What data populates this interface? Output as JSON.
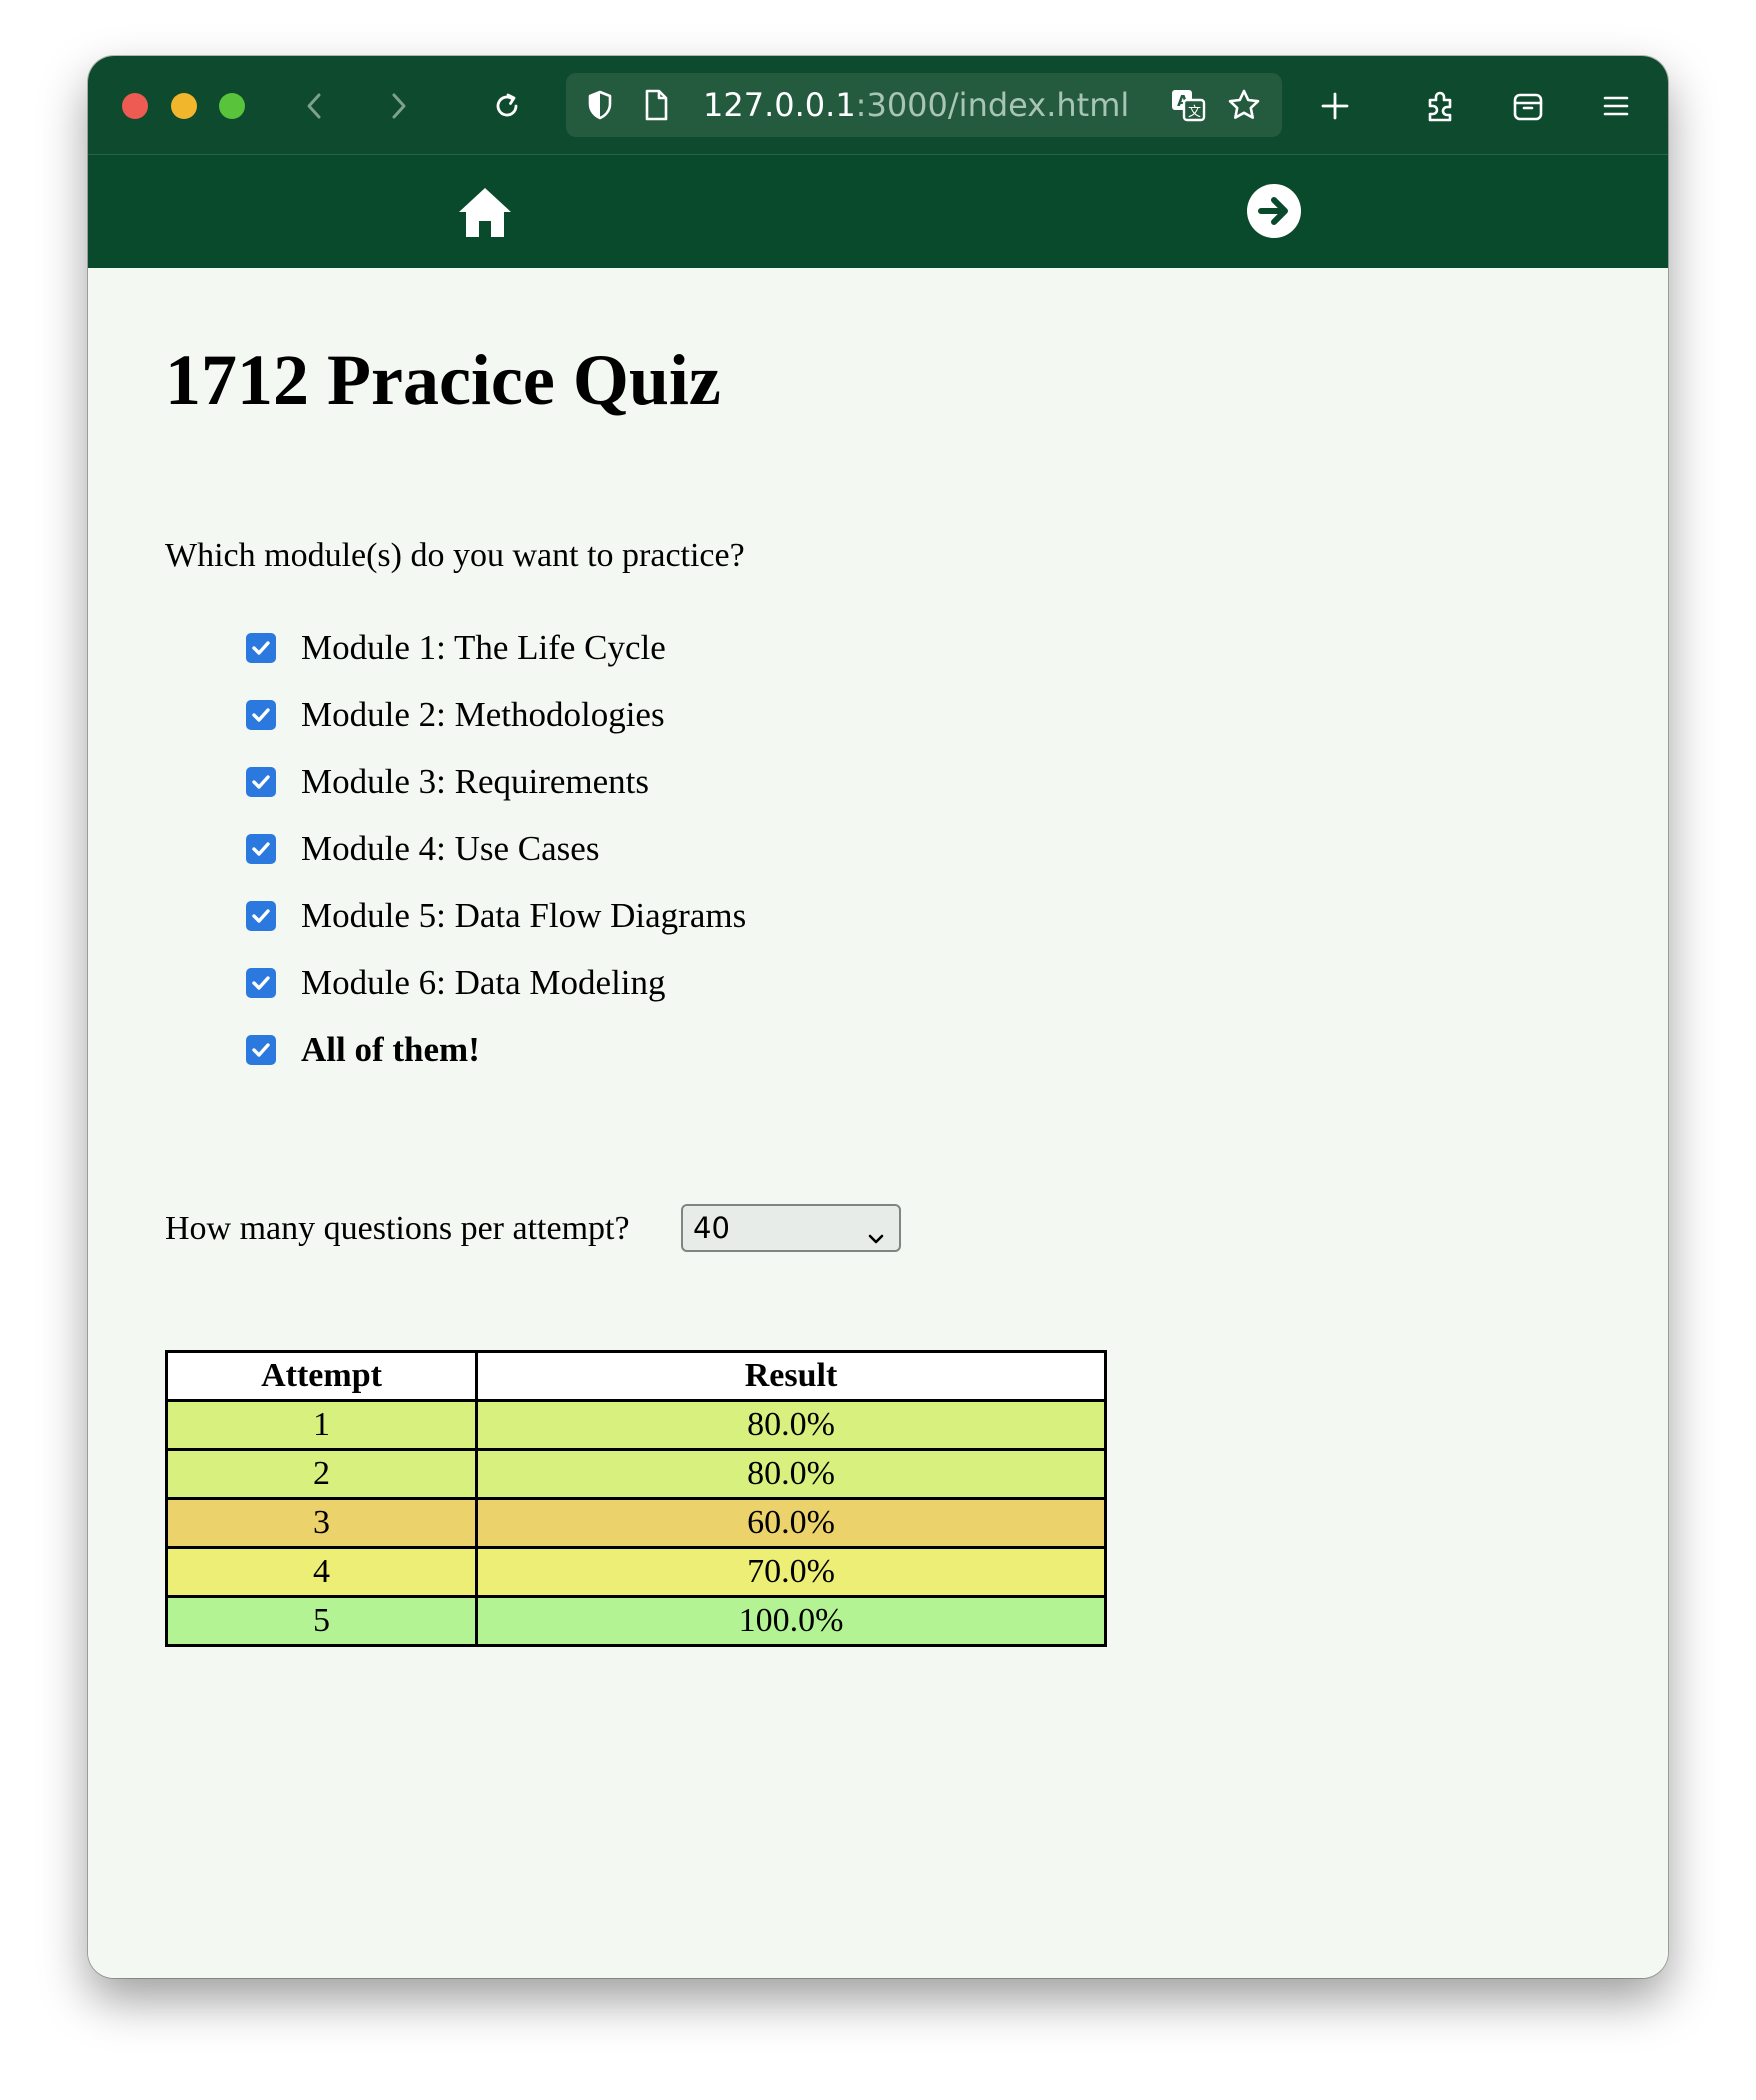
{
  "browser": {
    "url_host": "127.0.0.1",
    "url_rest": ":3000/index.html"
  },
  "page": {
    "title": "1712 Pracice Quiz",
    "module_question": "Which module(s) do you want to practice?",
    "modules": [
      {
        "label": "Module 1: The Life Cycle",
        "checked": true
      },
      {
        "label": "Module 2: Methodologies",
        "checked": true
      },
      {
        "label": "Module 3: Requirements",
        "checked": true
      },
      {
        "label": "Module 4: Use Cases",
        "checked": true
      },
      {
        "label": "Module 5: Data Flow Diagrams",
        "checked": true
      },
      {
        "label": "Module 6: Data Modeling",
        "checked": true
      },
      {
        "label": "All of them!",
        "checked": true
      }
    ],
    "questions_label": "How many questions per attempt?",
    "questions_selected": "40"
  },
  "results": {
    "headers": [
      "Attempt",
      "Result"
    ],
    "rows": [
      {
        "attempt": "1",
        "result": "80.0%",
        "color": "#d8f07e"
      },
      {
        "attempt": "2",
        "result": "80.0%",
        "color": "#d8f07e"
      },
      {
        "attempt": "3",
        "result": "60.0%",
        "color": "#ecd26b"
      },
      {
        "attempt": "4",
        "result": "70.0%",
        "color": "#edee76"
      },
      {
        "attempt": "5",
        "result": "100.0%",
        "color": "#b4f394"
      }
    ]
  },
  "colors": {
    "toolbar": "#0e4a2e",
    "nav": "#0a4a2c",
    "page_bg": "#f3f9f2",
    "checkbox": "#2b79de"
  }
}
